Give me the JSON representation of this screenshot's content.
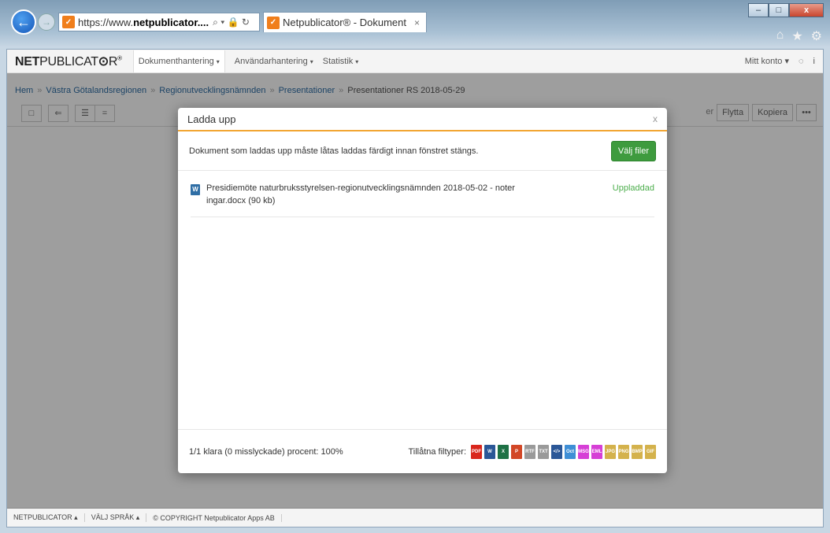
{
  "browser": {
    "url_proto": "https://www.",
    "url_domain": "netpublicator....",
    "tab_title": "Netpublicator® - Dokument",
    "tab_close": "×",
    "back_glyph": "←",
    "forward_glyph": "→",
    "addr_icons": "⌕ ▾ 🔒 ↻",
    "home_icon": "⌂",
    "favorites_icon": "★",
    "settings_icon": "⚙",
    "win_min": "–",
    "win_max": "□",
    "win_close": "x"
  },
  "app": {
    "logo_bold": "NET",
    "logo_rest": "PUBLICAT",
    "logo_o": "⊙",
    "logo_end": "R",
    "logo_reg": "®",
    "menu": [
      {
        "label": "Dokumenthantering"
      },
      {
        "label": "Användarhantering"
      },
      {
        "label": "Statistik"
      }
    ],
    "caret": "▾",
    "account": "Mitt konto",
    "right_icons": [
      "◌",
      "i"
    ]
  },
  "breadcrumb": {
    "items": [
      "Hem",
      "Västra Götalandsregionen",
      "Regionutvecklingsnämnden",
      "Presentationer"
    ],
    "current": "Presentationer RS 2018-05-29",
    "sep": "»"
  },
  "toolbar": {
    "left_buttons": [
      "□",
      "⇐",
      "☰",
      "="
    ],
    "partial_label": "er",
    "move": "Flytta",
    "copy": "Kopiera",
    "more": "•••"
  },
  "modal": {
    "title": "Ladda upp",
    "close": "x",
    "info": "Dokument som laddas upp måste låtas laddas färdigt innan fönstret stängs.",
    "choose_files": "Välj filer",
    "files": [
      {
        "icon": "W",
        "name": "Presidiemöte naturbruksstyrelsen-regionutvecklingsnämnden 2018-05-02 - noter ingar.docx (90 kb)",
        "status": "Uppladdad"
      }
    ],
    "progress": "1/1 klara (0 misslyckade) procent: 100%",
    "allowed_label": "Tillåtna filtyper:",
    "filetypes": [
      {
        "label": "PDF",
        "color": "#d9261c"
      },
      {
        "label": "W",
        "color": "#2b5797"
      },
      {
        "label": "X",
        "color": "#1e7145"
      },
      {
        "label": "P",
        "color": "#d24726"
      },
      {
        "label": "RTF",
        "color": "#9a9a9a"
      },
      {
        "label": "TXT",
        "color": "#9a9a9a"
      },
      {
        "label": "</>",
        "color": "#2b5797"
      },
      {
        "label": "Oct",
        "color": "#3f8fd6"
      },
      {
        "label": "MSG",
        "color": "#d63fd6"
      },
      {
        "label": "EML",
        "color": "#d63fd6"
      },
      {
        "label": "JPG",
        "color": "#d4b24c"
      },
      {
        "label": "PNG",
        "color": "#d4b24c"
      },
      {
        "label": "BMP",
        "color": "#d4b24c"
      },
      {
        "label": "GIF",
        "color": "#d4b24c"
      }
    ]
  },
  "footer": {
    "items": [
      "NETPUBLICATOR ▴",
      "VÄLJ SPRÅK ▴",
      "© COPYRIGHT Netpublicator Apps AB"
    ]
  },
  "colors": {
    "accent": "#f2a531",
    "success": "#4cae4c",
    "button_green": "#3e9b3e",
    "link": "#2f6ea5"
  }
}
